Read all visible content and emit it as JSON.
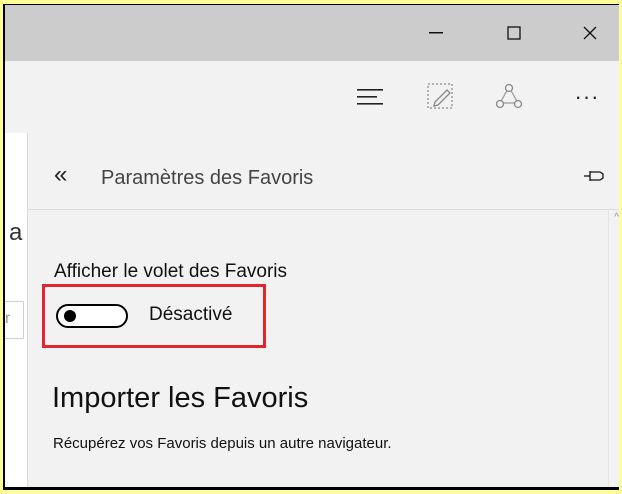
{
  "window_controls": {
    "minimize": "—",
    "maximize": "☐",
    "close": "✕"
  },
  "toolbar": {
    "icons": [
      "hub-icon",
      "web-note-icon",
      "share-icon",
      "more-icon"
    ],
    "more_glyph": "···"
  },
  "page_behind": {
    "letter": "a",
    "input_fragment": "r"
  },
  "hub": {
    "back_glyph": "«",
    "title": "Paramètres des Favoris",
    "favorites_bar": {
      "label": "Afficher le volet des Favoris",
      "toggle_state": "off",
      "status_text": "Désactivé"
    },
    "import": {
      "heading": "Importer les Favoris",
      "description": "Récupérez vos Favoris depuis un autre navigateur."
    }
  },
  "colors": {
    "highlight_border": "#e0262e",
    "titlebar": "#cccccc",
    "hub_background": "#f2f2f2",
    "outer_background": "#ffff99"
  }
}
